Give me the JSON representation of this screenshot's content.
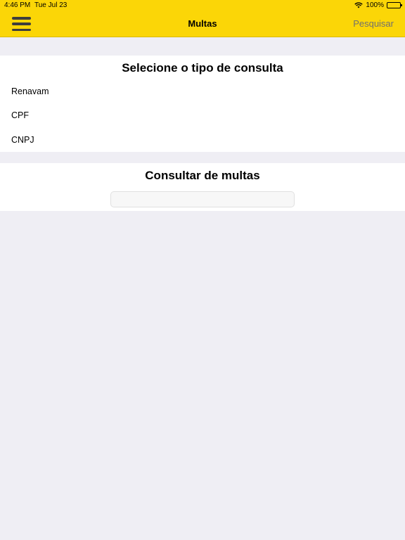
{
  "status_bar": {
    "time": "4:46 PM",
    "date": "Tue Jul 23",
    "battery": "100%"
  },
  "nav": {
    "title": "Multas",
    "action": "Pesquisar"
  },
  "query_type": {
    "title": "Selecione o tipo de consulta",
    "options": [
      "Renavam",
      "CPF",
      "CNPJ"
    ]
  },
  "search": {
    "title": "Consultar de multas",
    "value": "",
    "placeholder": ""
  },
  "colors": {
    "accent": "#fbd607",
    "background": "#efeef4"
  }
}
